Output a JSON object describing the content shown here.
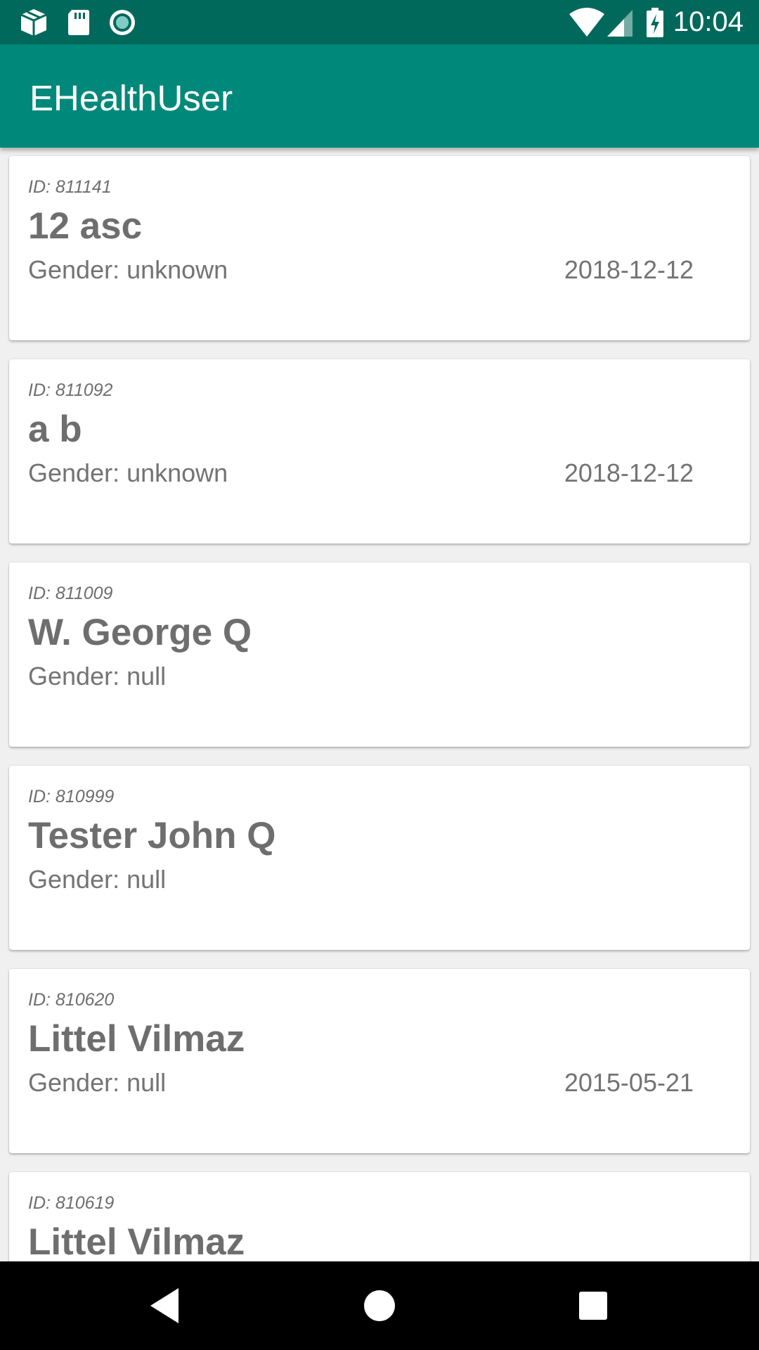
{
  "status_bar": {
    "time": "10:04",
    "left_icons": [
      "package-icon",
      "sd-card-icon",
      "circle-record-icon"
    ],
    "right_icons": [
      "wifi-icon",
      "cell-signal-icon",
      "battery-charging-icon"
    ]
  },
  "app_bar": {
    "title": "EHealthUser",
    "color": "#00897b"
  },
  "patients": [
    {
      "id": "ID: 811141",
      "name": "12 asc",
      "gender": "Gender: unknown",
      "date": "2018-12-12"
    },
    {
      "id": "ID: 811092",
      "name": "a b",
      "gender": "Gender: unknown",
      "date": "2018-12-12"
    },
    {
      "id": "ID: 811009",
      "name": "W. George Q",
      "gender": "Gender: null",
      "date": ""
    },
    {
      "id": "ID: 810999",
      "name": "Tester John Q",
      "gender": "Gender: null",
      "date": ""
    },
    {
      "id": "ID: 810620",
      "name": "Littel Vilmaz",
      "gender": "Gender: null",
      "date": "2015-05-21"
    },
    {
      "id": "ID: 810619",
      "name": "Littel Vilmaz",
      "gender": "",
      "date": ""
    }
  ],
  "nav_bar": {
    "buttons": [
      "back-icon",
      "home-icon",
      "recents-icon"
    ]
  }
}
